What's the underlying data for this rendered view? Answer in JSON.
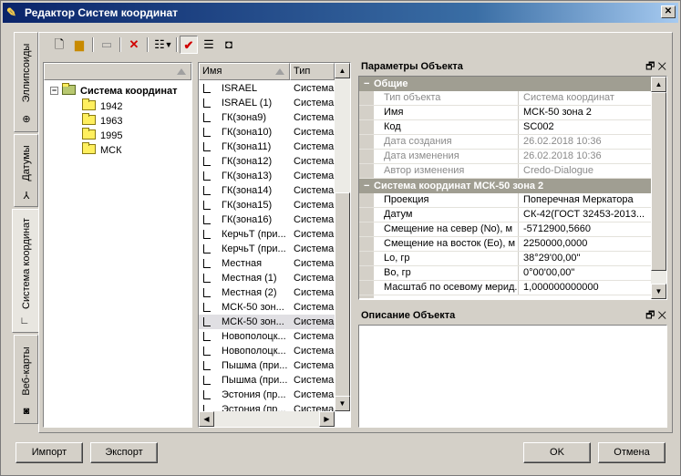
{
  "window": {
    "title": "Редактор Систем координат",
    "close": "✕"
  },
  "side_tabs": [
    {
      "label": "Эллипсоиды",
      "icon": "ellipsoid-icon"
    },
    {
      "label": "Датумы",
      "icon": "datum-icon"
    },
    {
      "label": "Система координат",
      "icon": "coordinate-system-icon"
    },
    {
      "label": "Веб-карты",
      "icon": "web-map-icon"
    }
  ],
  "toolbar": {
    "icons": [
      "new-document-icon",
      "add-folder-icon",
      "import-icon",
      "delete-icon",
      "list-view-icon",
      "dropdown-arrow-icon",
      "checkmark-icon",
      "properties-icon",
      "binoculars-icon"
    ]
  },
  "tree": {
    "root": "Система координат",
    "children": [
      "1942",
      "1963",
      "1995",
      "МСК"
    ]
  },
  "list": {
    "col_name": "Имя",
    "col_type": "Тип",
    "rows": [
      {
        "name": "ISRAEL",
        "type": "Система"
      },
      {
        "name": "ISRAEL (1)",
        "type": "Система"
      },
      {
        "name": "ГК(зона9)",
        "type": "Система"
      },
      {
        "name": "ГК(зона10)",
        "type": "Система"
      },
      {
        "name": "ГК(зона11)",
        "type": "Система"
      },
      {
        "name": "ГК(зона12)",
        "type": "Система"
      },
      {
        "name": "ГК(зона13)",
        "type": "Система"
      },
      {
        "name": "ГК(зона14)",
        "type": "Система"
      },
      {
        "name": "ГК(зона15)",
        "type": "Система"
      },
      {
        "name": "ГК(зона16)",
        "type": "Система"
      },
      {
        "name": "КерчьТ (при...",
        "type": "Система"
      },
      {
        "name": "КерчьТ (при...",
        "type": "Система"
      },
      {
        "name": "Местная",
        "type": "Система"
      },
      {
        "name": "Местная (1)",
        "type": "Система"
      },
      {
        "name": "Местная (2)",
        "type": "Система"
      },
      {
        "name": "МСК-50 зон...",
        "type": "Система"
      },
      {
        "name": "МСК-50 зон...",
        "type": "Система"
      },
      {
        "name": "Новополоцк...",
        "type": "Система"
      },
      {
        "name": "Новополоцк...",
        "type": "Система"
      },
      {
        "name": "Пышма (при...",
        "type": "Система"
      },
      {
        "name": "Пышма (при...",
        "type": "Система"
      },
      {
        "name": "Эстония (пр...",
        "type": "Система"
      },
      {
        "name": "Эстония (пр...",
        "type": "Система"
      }
    ],
    "selected_index": 16
  },
  "params": {
    "title": "Параметры Объекта",
    "pin": "🗗",
    "close": "✕",
    "categories": [
      {
        "title": "Общие",
        "rows": [
          {
            "key": "Тип объекта",
            "value": "Система координат",
            "readonly": true
          },
          {
            "key": "Имя",
            "value": "МСК-50 зона 2",
            "readonly": false
          },
          {
            "key": "Код",
            "value": "SC002",
            "readonly": false
          },
          {
            "key": "Дата создания",
            "value": "26.02.2018 10:36",
            "readonly": true
          },
          {
            "key": "Дата изменения",
            "value": "26.02.2018 10:36",
            "readonly": true
          },
          {
            "key": "Автор изменения",
            "value": "Credo-Dialogue",
            "readonly": true
          }
        ]
      },
      {
        "title": "Система координат МСК-50 зона 2",
        "rows": [
          {
            "key": "Проекция",
            "value": "Поперечная Меркатора",
            "readonly": false
          },
          {
            "key": "Датум",
            "value": "СК-42(ГОСТ 32453-2013...",
            "readonly": false
          },
          {
            "key": "Смещение на север (No), м",
            "value": "-5712900,5660",
            "readonly": false
          },
          {
            "key": "Смещение на восток (Eo), м",
            "value": "2250000,0000",
            "readonly": false
          },
          {
            "key": "Lo, гр",
            "value": "  38°29'00,00\"",
            "readonly": false
          },
          {
            "key": "Bo, гр",
            "value": "  0°00'00,00\"",
            "readonly": false
          },
          {
            "key": "Масштаб по осевому мерид...",
            "value": "1,000000000000",
            "readonly": false
          }
        ]
      }
    ]
  },
  "description": {
    "title": "Описание Объекта",
    "pin": "🗗",
    "close": "✕"
  },
  "buttons": {
    "import": "Импорт",
    "export": "Экспорт",
    "ok": "OK",
    "cancel": "Отмена"
  }
}
